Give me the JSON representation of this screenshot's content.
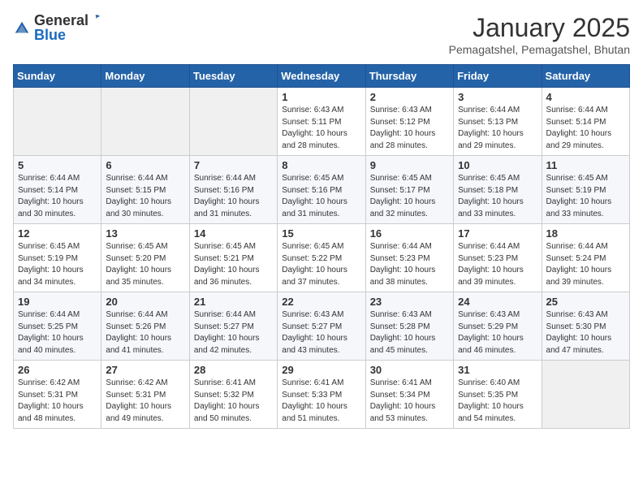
{
  "logo": {
    "general": "General",
    "blue": "Blue"
  },
  "title": "January 2025",
  "subtitle": "Pemagatshel, Pemagatshel, Bhutan",
  "days_of_week": [
    "Sunday",
    "Monday",
    "Tuesday",
    "Wednesday",
    "Thursday",
    "Friday",
    "Saturday"
  ],
  "weeks": [
    [
      {
        "day": "",
        "info": ""
      },
      {
        "day": "",
        "info": ""
      },
      {
        "day": "",
        "info": ""
      },
      {
        "day": "1",
        "info": "Sunrise: 6:43 AM\nSunset: 5:11 PM\nDaylight: 10 hours and 28 minutes."
      },
      {
        "day": "2",
        "info": "Sunrise: 6:43 AM\nSunset: 5:12 PM\nDaylight: 10 hours and 28 minutes."
      },
      {
        "day": "3",
        "info": "Sunrise: 6:44 AM\nSunset: 5:13 PM\nDaylight: 10 hours and 29 minutes."
      },
      {
        "day": "4",
        "info": "Sunrise: 6:44 AM\nSunset: 5:14 PM\nDaylight: 10 hours and 29 minutes."
      }
    ],
    [
      {
        "day": "5",
        "info": "Sunrise: 6:44 AM\nSunset: 5:14 PM\nDaylight: 10 hours and 30 minutes."
      },
      {
        "day": "6",
        "info": "Sunrise: 6:44 AM\nSunset: 5:15 PM\nDaylight: 10 hours and 30 minutes."
      },
      {
        "day": "7",
        "info": "Sunrise: 6:44 AM\nSunset: 5:16 PM\nDaylight: 10 hours and 31 minutes."
      },
      {
        "day": "8",
        "info": "Sunrise: 6:45 AM\nSunset: 5:16 PM\nDaylight: 10 hours and 31 minutes."
      },
      {
        "day": "9",
        "info": "Sunrise: 6:45 AM\nSunset: 5:17 PM\nDaylight: 10 hours and 32 minutes."
      },
      {
        "day": "10",
        "info": "Sunrise: 6:45 AM\nSunset: 5:18 PM\nDaylight: 10 hours and 33 minutes."
      },
      {
        "day": "11",
        "info": "Sunrise: 6:45 AM\nSunset: 5:19 PM\nDaylight: 10 hours and 33 minutes."
      }
    ],
    [
      {
        "day": "12",
        "info": "Sunrise: 6:45 AM\nSunset: 5:19 PM\nDaylight: 10 hours and 34 minutes."
      },
      {
        "day": "13",
        "info": "Sunrise: 6:45 AM\nSunset: 5:20 PM\nDaylight: 10 hours and 35 minutes."
      },
      {
        "day": "14",
        "info": "Sunrise: 6:45 AM\nSunset: 5:21 PM\nDaylight: 10 hours and 36 minutes."
      },
      {
        "day": "15",
        "info": "Sunrise: 6:45 AM\nSunset: 5:22 PM\nDaylight: 10 hours and 37 minutes."
      },
      {
        "day": "16",
        "info": "Sunrise: 6:44 AM\nSunset: 5:23 PM\nDaylight: 10 hours and 38 minutes."
      },
      {
        "day": "17",
        "info": "Sunrise: 6:44 AM\nSunset: 5:23 PM\nDaylight: 10 hours and 39 minutes."
      },
      {
        "day": "18",
        "info": "Sunrise: 6:44 AM\nSunset: 5:24 PM\nDaylight: 10 hours and 39 minutes."
      }
    ],
    [
      {
        "day": "19",
        "info": "Sunrise: 6:44 AM\nSunset: 5:25 PM\nDaylight: 10 hours and 40 minutes."
      },
      {
        "day": "20",
        "info": "Sunrise: 6:44 AM\nSunset: 5:26 PM\nDaylight: 10 hours and 41 minutes."
      },
      {
        "day": "21",
        "info": "Sunrise: 6:44 AM\nSunset: 5:27 PM\nDaylight: 10 hours and 42 minutes."
      },
      {
        "day": "22",
        "info": "Sunrise: 6:43 AM\nSunset: 5:27 PM\nDaylight: 10 hours and 43 minutes."
      },
      {
        "day": "23",
        "info": "Sunrise: 6:43 AM\nSunset: 5:28 PM\nDaylight: 10 hours and 45 minutes."
      },
      {
        "day": "24",
        "info": "Sunrise: 6:43 AM\nSunset: 5:29 PM\nDaylight: 10 hours and 46 minutes."
      },
      {
        "day": "25",
        "info": "Sunrise: 6:43 AM\nSunset: 5:30 PM\nDaylight: 10 hours and 47 minutes."
      }
    ],
    [
      {
        "day": "26",
        "info": "Sunrise: 6:42 AM\nSunset: 5:31 PM\nDaylight: 10 hours and 48 minutes."
      },
      {
        "day": "27",
        "info": "Sunrise: 6:42 AM\nSunset: 5:31 PM\nDaylight: 10 hours and 49 minutes."
      },
      {
        "day": "28",
        "info": "Sunrise: 6:41 AM\nSunset: 5:32 PM\nDaylight: 10 hours and 50 minutes."
      },
      {
        "day": "29",
        "info": "Sunrise: 6:41 AM\nSunset: 5:33 PM\nDaylight: 10 hours and 51 minutes."
      },
      {
        "day": "30",
        "info": "Sunrise: 6:41 AM\nSunset: 5:34 PM\nDaylight: 10 hours and 53 minutes."
      },
      {
        "day": "31",
        "info": "Sunrise: 6:40 AM\nSunset: 5:35 PM\nDaylight: 10 hours and 54 minutes."
      },
      {
        "day": "",
        "info": ""
      }
    ]
  ]
}
